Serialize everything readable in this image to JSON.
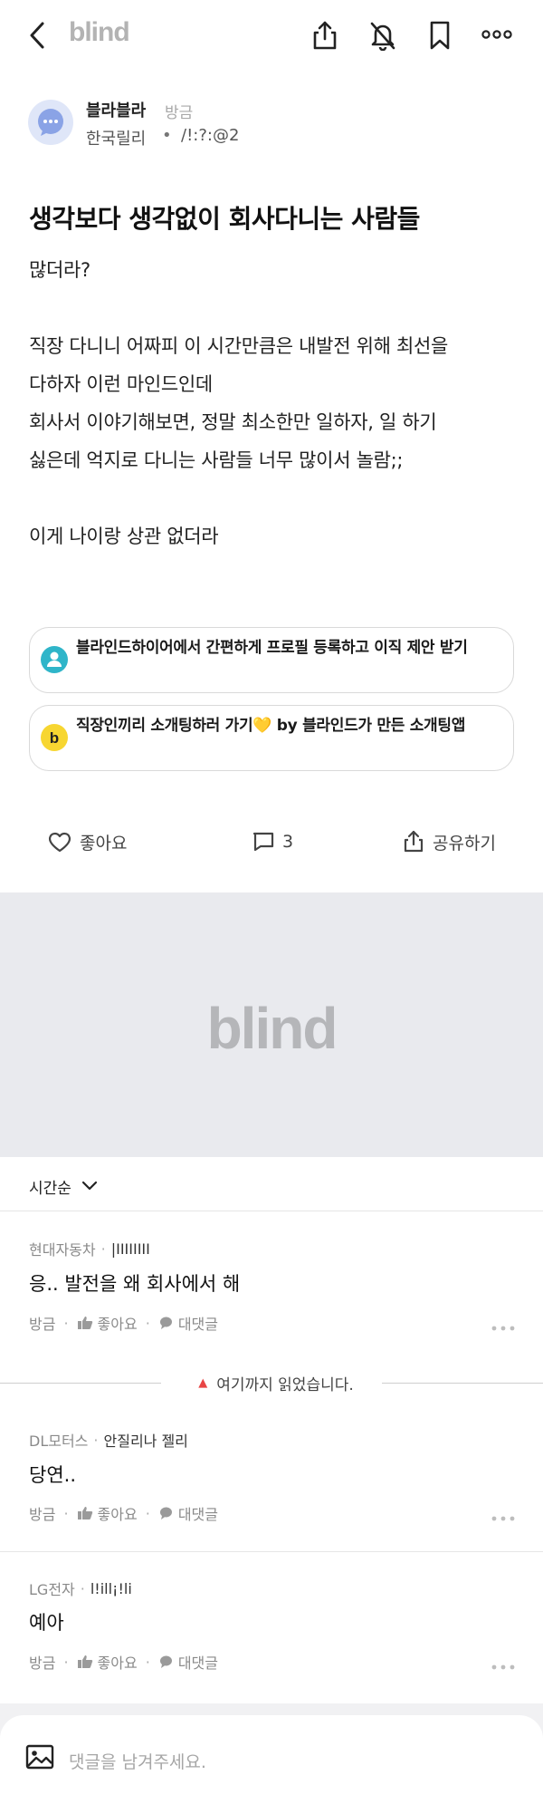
{
  "header": {
    "logo": "blind",
    "back_icon": "chevron-left-icon",
    "share_icon": "share-icon",
    "notify_icon": "bell-off-icon",
    "bookmark_icon": "bookmark-icon",
    "more_icon": "more-icon"
  },
  "author": {
    "name": "블라블라",
    "time": "방금",
    "company": "한국릴리",
    "dot": "•",
    "nickname": "/!:?:@2"
  },
  "post": {
    "title": "생각보다 생각없이 회사다니는 사람들",
    "body": "많더라?\n\n직장 다니니 어짜피 이 시간만큼은 내발전 위해 최선을\n다하자 이런 마인드인데\n회사서 이야기해보면, 정말 최소한만 일하자, 일 하기\n싫은데 억지로 다니는 사람들 너무 많이서 놀람;;\n\n이게 나이랑 상관 없더라"
  },
  "promos": [
    {
      "text": "블라인드하이어에서 간편하게 프로필 등록하고 이직 제안 받기",
      "icon": "person-icon",
      "color": "#2fb5c9"
    },
    {
      "text": "직장인끼리 소개팅하러 가기💛 by 블라인드가 만든 소개팅앱",
      "icon": "b-icon",
      "color": "#f7d631"
    }
  ],
  "actions": {
    "like_label": "좋아요",
    "comment_count": "3",
    "share_label": "공유하기"
  },
  "ad": {
    "logo": "blind"
  },
  "sort": {
    "label": "시간순"
  },
  "read_marker": {
    "tri": "▲",
    "label": "여기까지 읽었습니다."
  },
  "comments": [
    {
      "company": "현대자동차",
      "sep": "·",
      "nickname": "|IIIIIIII",
      "text": "응.. 발전을 왜 회사에서 해",
      "time": "방금",
      "like": "좋아요",
      "reply": "대댓글",
      "dot": "·"
    },
    {
      "company": "DL모터스",
      "sep": "·",
      "nickname": "안질리나 젤리",
      "text": "당연..",
      "time": "방금",
      "like": "좋아요",
      "reply": "대댓글",
      "dot": "·"
    },
    {
      "company": "LG전자",
      "sep": "·",
      "nickname": "l!ill¡!li",
      "text": "예아",
      "time": "방금",
      "like": "좋아요",
      "reply": "대댓글",
      "dot": "·"
    }
  ],
  "composer": {
    "placeholder": "댓글을 남겨주세요.",
    "image_icon": "image-icon"
  },
  "colors": {
    "accent_red": "#e84545",
    "logo_gray": "#b3b3b3",
    "ad_bg": "#e9eaee"
  }
}
